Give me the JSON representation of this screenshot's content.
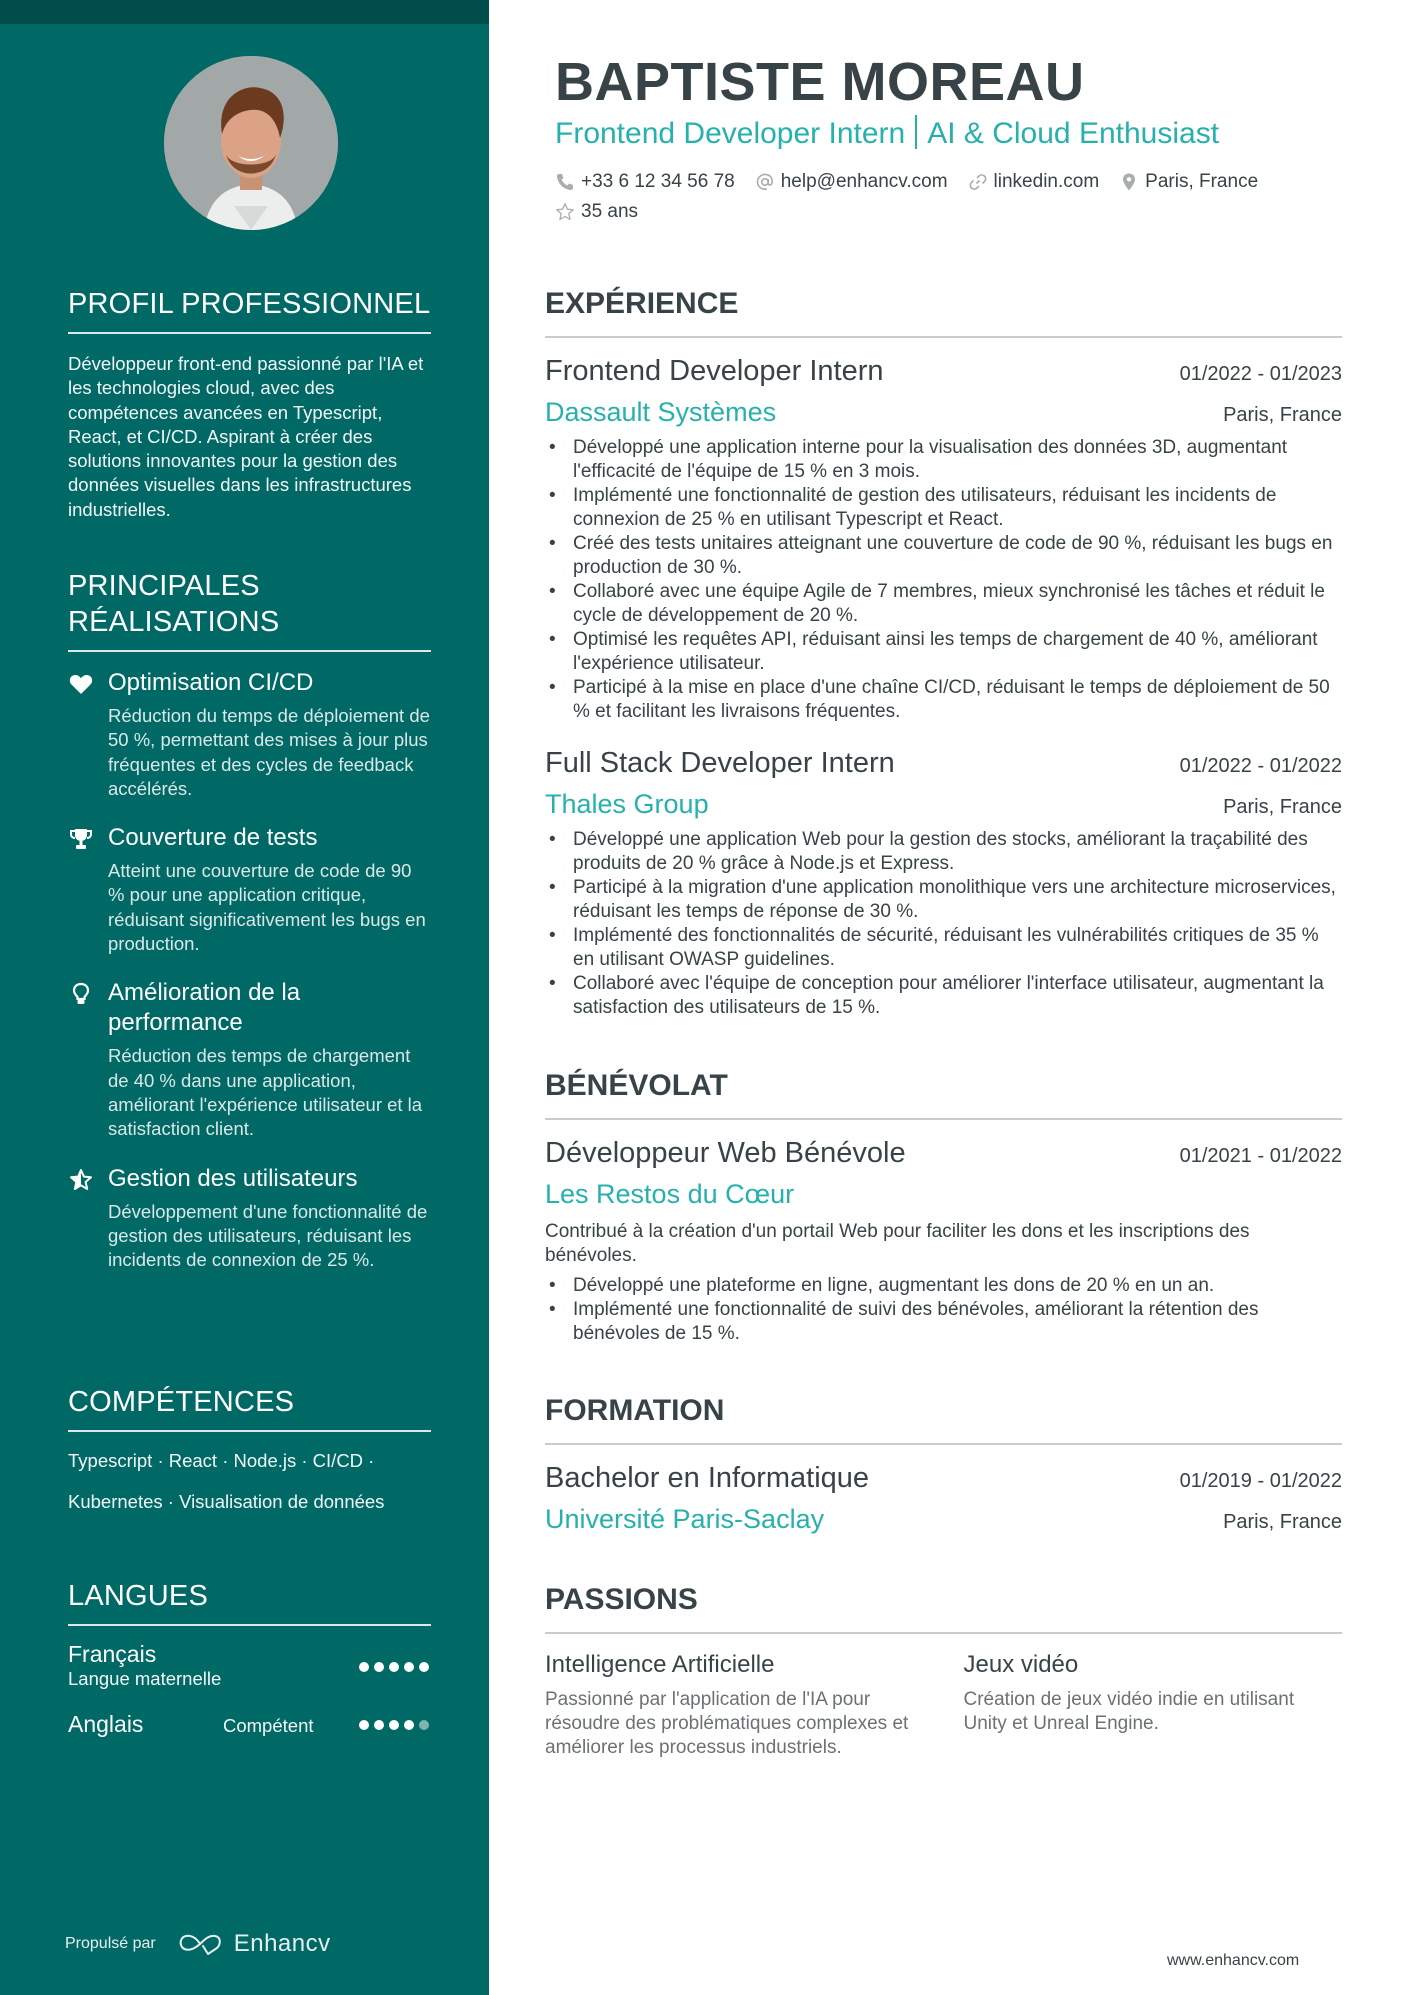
{
  "sidebar": {
    "avatar_alt": "Portrait photo",
    "profile": {
      "title": "PROFIL PROFESSIONNEL",
      "text": "Développeur front-end passionné par l'IA et les technologies cloud, avec des compétences avancées en Typescript, React, et CI/CD. Aspirant à créer des solutions innovantes pour la gestion des données visuelles dans les infrastructures industrielles."
    },
    "achievements": {
      "title_line1": "PRINCIPALES",
      "title_line2": "RÉALISATIONS",
      "items": [
        {
          "icon": "heart-icon",
          "title": "Optimisation CI/CD",
          "desc": "Réduction du temps de déploiement de 50 %, permettant des mises à jour plus fréquentes et des cycles de feedback accélérés."
        },
        {
          "icon": "trophy-icon",
          "title": "Couverture de tests",
          "desc": "Atteint une couverture de code de 90 % pour une application critique, réduisant significativement les bugs en production."
        },
        {
          "icon": "lightbulb-icon",
          "title": "Amélioration de la performance",
          "desc": "Réduction des temps de chargement de 40 % dans une application, améliorant l'expérience utilisateur et la satisfaction client."
        },
        {
          "icon": "star-half-icon",
          "title": "Gestion des utilisateurs",
          "desc": "Développement d'une fonctionnalité de gestion des utilisateurs, réduisant les incidents de connexion de 25 %."
        }
      ]
    },
    "skills": {
      "title": "COMPÉTENCES",
      "line1": "Typescript · React · Node.js · CI/CD ·",
      "line2": "Kubernetes · Visualisation de données"
    },
    "languages": {
      "title": "LANGUES",
      "items": [
        {
          "name": "Français",
          "level": "Langue maternelle",
          "rating": 5,
          "max": 5
        },
        {
          "name": "Anglais",
          "level": "Compétent",
          "rating": 4,
          "max": 5
        }
      ]
    },
    "footer": {
      "powered_by": "Propulsé par",
      "brand": "Enhancv"
    }
  },
  "header": {
    "name": "BAPTISTE MOREAU",
    "headline_part1": "Frontend Developer Intern",
    "headline_part2": "AI & Cloud Enthusiast",
    "contacts": {
      "phone": "+33 6 12 34 56 78",
      "email": "help@enhancv.com",
      "link": "linkedin.com",
      "location": "Paris, France",
      "age": "35 ans"
    }
  },
  "experience": {
    "title": "EXPÉRIENCE",
    "entries": [
      {
        "role": "Frontend Developer Intern",
        "dates": "01/2022 - 01/2023",
        "org": "Dassault Systèmes",
        "location": "Paris, France",
        "bullets": [
          "Développé une application interne pour la visualisation des données 3D, augmentant l'efficacité de l'équipe de 15 % en 3 mois.",
          "Implémenté une fonctionnalité de gestion des utilisateurs, réduisant les incidents de connexion de 25 % en utilisant Typescript et React.",
          "Créé des tests unitaires atteignant une couverture de code de 90 %, réduisant les bugs en production de 30 %.",
          "Collaboré avec une équipe Agile de 7 membres, mieux synchronisé les tâches et réduit le cycle de développement de 20 %.",
          "Optimisé les requêtes API, réduisant ainsi les temps de chargement de 40 %, améliorant l'expérience utilisateur.",
          "Participé à la mise en place d'une chaîne CI/CD, réduisant le temps de déploiement de 50 % et facilitant les livraisons fréquentes."
        ]
      },
      {
        "role": "Full Stack Developer Intern",
        "dates": "01/2022 - 01/2022",
        "org": "Thales Group",
        "location": "Paris, France",
        "bullets": [
          "Développé une application Web pour la gestion des stocks, améliorant la traçabilité des produits de 20 % grâce à Node.js et Express.",
          "Participé à la migration d'une application monolithique vers une architecture microservices, réduisant les temps de réponse de 30 %.",
          "Implémenté des fonctionnalités de sécurité, réduisant les vulnérabilités critiques de 35 % en utilisant OWASP guidelines.",
          "Collaboré avec l'équipe de conception pour améliorer l'interface utilisateur, augmentant la satisfaction des utilisateurs de 15 %."
        ]
      }
    ]
  },
  "volunteering": {
    "title": "BÉNÉVOLAT",
    "role": "Développeur Web Bénévole",
    "dates": "01/2021 - 01/2022",
    "org": "Les Restos du Cœur",
    "description": "Contribué à la création d'un portail Web pour faciliter les dons et les inscriptions des bénévoles.",
    "bullets": [
      "Développé une plateforme en ligne, augmentant les dons de 20 % en un an.",
      "Implémenté une fonctionnalité de suivi des bénévoles, améliorant la rétention des bénévoles de 15 %."
    ]
  },
  "education": {
    "title": "FORMATION",
    "degree": "Bachelor en Informatique",
    "dates": "01/2019 - 01/2022",
    "school": "Université Paris-Saclay",
    "location": "Paris, France"
  },
  "passions": {
    "title": "PASSIONS",
    "items": [
      {
        "title": "Intelligence Artificielle",
        "desc": "Passionné par l'application de l'IA pour résoudre des problématiques complexes et améliorer les processus industriels."
      },
      {
        "title": "Jeux vidéo",
        "desc": "Création de jeux vidéo indie en utilisant Unity et Unreal Engine."
      }
    ]
  },
  "footer": {
    "website": "www.enhancv.com"
  },
  "colors": {
    "sidebar": "#006966",
    "sidebar_top": "#004d4b",
    "accent": "#26b1ad",
    "text": "#384347"
  }
}
